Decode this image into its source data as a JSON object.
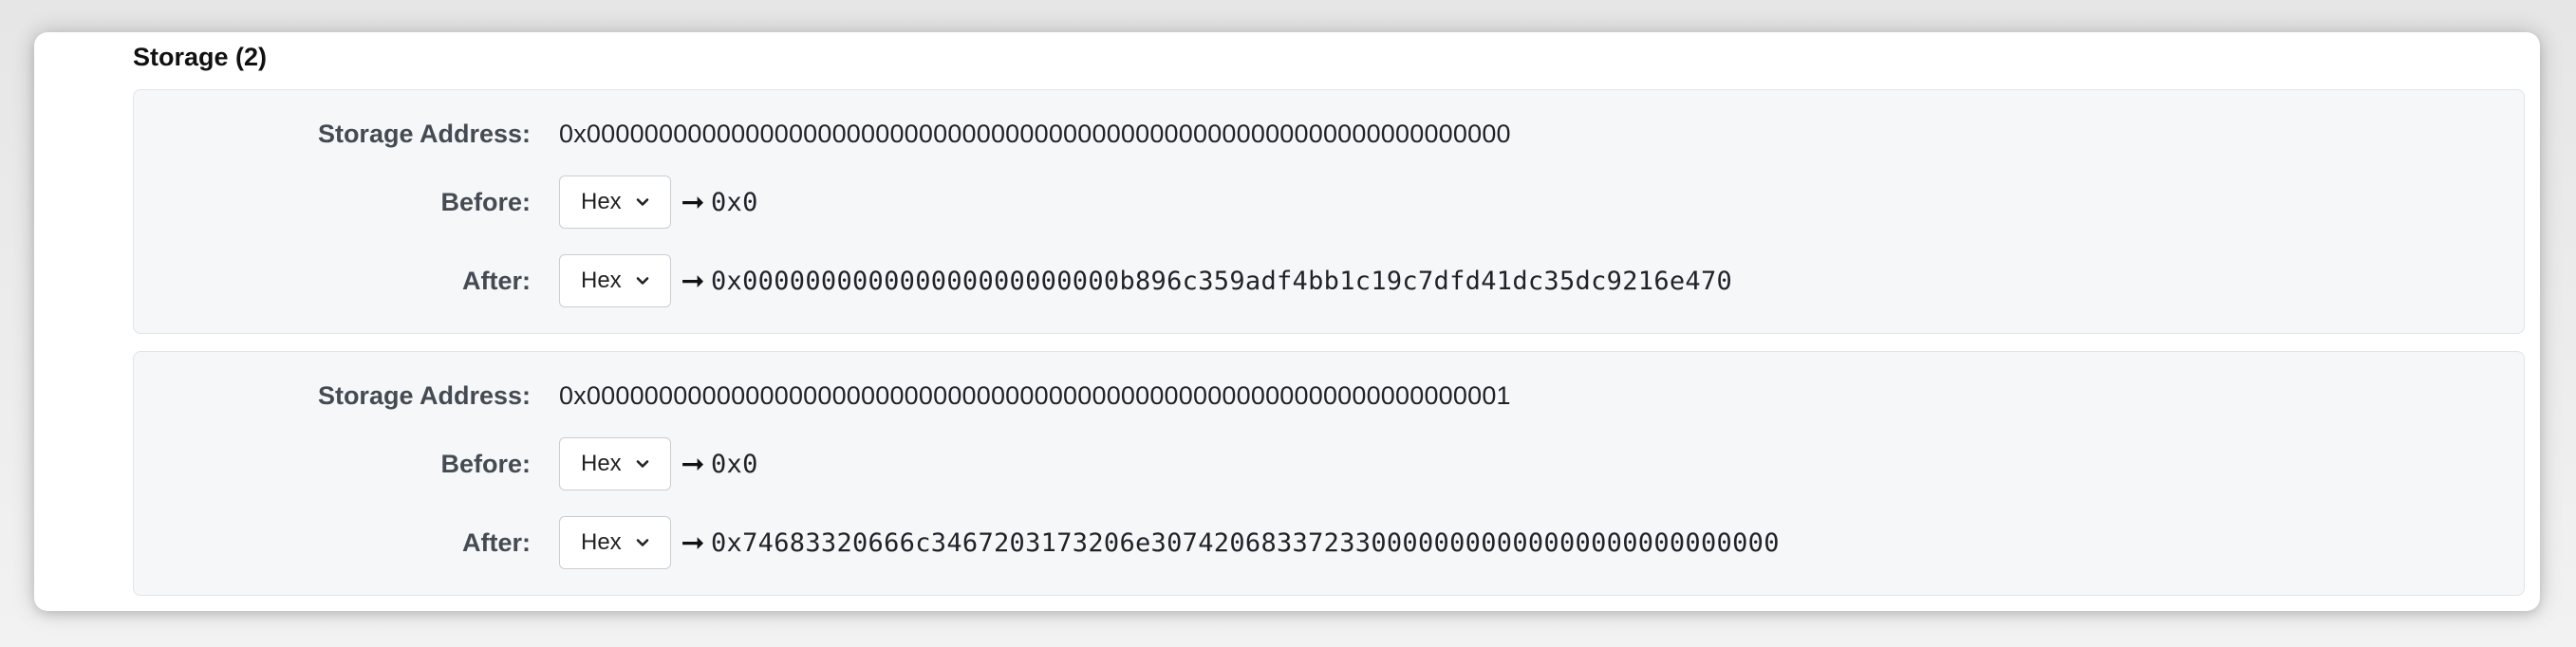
{
  "section": {
    "title": "Storage (2)"
  },
  "labels": {
    "storage_address": "Storage Address:",
    "before": "Before:",
    "after": "After:"
  },
  "icons": {
    "select_chevron": "chevron-down-icon",
    "arrow": "arrow-right-icon"
  },
  "arrow_glyph": "➞",
  "entries": [
    {
      "storage_address": "0x0000000000000000000000000000000000000000000000000000000000000000",
      "before_format": "Hex",
      "before_value": "0x0",
      "after_format": "Hex",
      "after_value": "0x000000000000000000000000b896c359adf4bb1c19c7dfd41dc35dc9216e470"
    },
    {
      "storage_address": "0x0000000000000000000000000000000000000000000000000000000000000001",
      "before_format": "Hex",
      "before_value": "0x0",
      "after_format": "Hex",
      "after_value": "0x74683320666c3467203173206e3074206833723300000000000000000000000000"
    }
  ]
}
